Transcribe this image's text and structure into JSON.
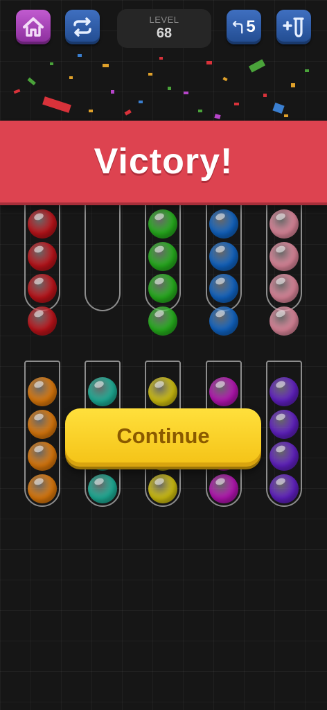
{
  "header": {
    "home_icon": "home-icon",
    "restart_icon": "restart-icon",
    "level_label": "LEVEL",
    "level_value": "68",
    "undo_icon": "undo-icon",
    "undo_count": "5",
    "add_tube_icon": "add-tube-icon"
  },
  "banner": {
    "text": "Victory!",
    "color": "#dd4350"
  },
  "continue_button": {
    "label": "Continue",
    "color": "#f9d626"
  },
  "ball_colors": {
    "red": "#c3141b",
    "green": "#27b51e",
    "blue": "#1167c9",
    "pink": "#e58ba0",
    "orange": "#e47d0c",
    "teal": "#1fb49c",
    "yellow": "#d7c611",
    "magenta": "#bb15b8",
    "purple": "#6421c9"
  },
  "top_row_tubes": [
    {
      "color": "red",
      "balls": 4
    },
    {
      "color": "",
      "balls": 0
    },
    {
      "color": "green",
      "balls": 4
    },
    {
      "color": "blue",
      "balls": 4
    },
    {
      "color": "pink",
      "balls": 4
    }
  ],
  "bottom_row_tubes": [
    {
      "color": "orange",
      "balls": 4
    },
    {
      "color": "teal",
      "balls": 4
    },
    {
      "color": "yellow",
      "balls": 4
    },
    {
      "color": "magenta",
      "balls": 4
    },
    {
      "color": "purple",
      "balls": 4
    }
  ]
}
